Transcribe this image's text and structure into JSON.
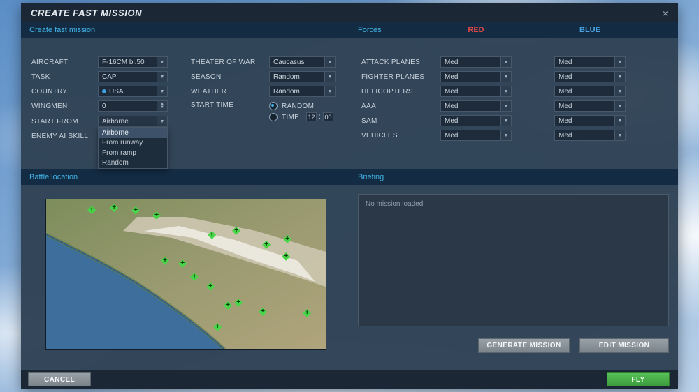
{
  "window": {
    "title": "CREATE FAST MISSION",
    "close_icon": "×"
  },
  "sections": {
    "create": "Create fast mission",
    "forces": "Forces",
    "red": "RED",
    "blue": "BLUE",
    "battle": "Battle location",
    "briefing": "Briefing"
  },
  "form": {
    "aircraft": {
      "label": "AIRCRAFT",
      "value": "F-16CM bl.50"
    },
    "task": {
      "label": "TASK",
      "value": "CAP"
    },
    "country": {
      "label": "COUNTRY",
      "value": "USA"
    },
    "wingmen": {
      "label": "WINGMEN",
      "value": "0"
    },
    "start_from": {
      "label": "START FROM",
      "value": "Airborne",
      "options": [
        "Airborne",
        "From runway",
        "From ramp",
        "Random"
      ]
    },
    "enemy_ai": {
      "label": "ENEMY AI SKILL"
    },
    "theater": {
      "label": "THEATER OF WAR",
      "value": "Caucasus"
    },
    "season": {
      "label": "SEASON",
      "value": "Random"
    },
    "weather": {
      "label": "WEATHER",
      "value": "Random"
    },
    "start_time": {
      "label": "START TIME",
      "random": "RANDOM",
      "time": "TIME",
      "hour": "12",
      "sep": ":",
      "minute": "00"
    }
  },
  "forces": {
    "rows": [
      {
        "label": "ATTACK PLANES",
        "red": "Med",
        "blue": "Med"
      },
      {
        "label": "FIGHTER PLANES",
        "red": "Med",
        "blue": "Med"
      },
      {
        "label": "HELICOPTERS",
        "red": "Med",
        "blue": "Med"
      },
      {
        "label": "AAA",
        "red": "Med",
        "blue": "Med"
      },
      {
        "label": "SAM",
        "red": "Med",
        "blue": "Med"
      },
      {
        "label": "VEHICLES",
        "red": "Med",
        "blue": "Med"
      }
    ]
  },
  "briefing": {
    "placeholder": "No mission loaded",
    "generate": "GENERATE MISSION",
    "edit": "EDIT MISSION"
  },
  "footer": {
    "cancel": "CANCEL",
    "fly": "FLY"
  },
  "map": {
    "markers": [
      {
        "x": 16.3,
        "y": 7.0
      },
      {
        "x": 24.3,
        "y": 5.6
      },
      {
        "x": 32.0,
        "y": 7.4
      },
      {
        "x": 39.5,
        "y": 10.7
      },
      {
        "x": 59.3,
        "y": 23.7
      },
      {
        "x": 68.0,
        "y": 20.9
      },
      {
        "x": 78.8,
        "y": 30.2
      },
      {
        "x": 86.3,
        "y": 26.5
      },
      {
        "x": 85.8,
        "y": 38.1
      },
      {
        "x": 42.5,
        "y": 40.9
      },
      {
        "x": 48.8,
        "y": 42.8
      },
      {
        "x": 53.0,
        "y": 51.6
      },
      {
        "x": 58.8,
        "y": 58.1
      },
      {
        "x": 65.0,
        "y": 70.7
      },
      {
        "x": 68.8,
        "y": 68.8
      },
      {
        "x": 77.5,
        "y": 74.9
      },
      {
        "x": 93.3,
        "y": 75.8
      },
      {
        "x": 61.3,
        "y": 85.1
      }
    ]
  }
}
